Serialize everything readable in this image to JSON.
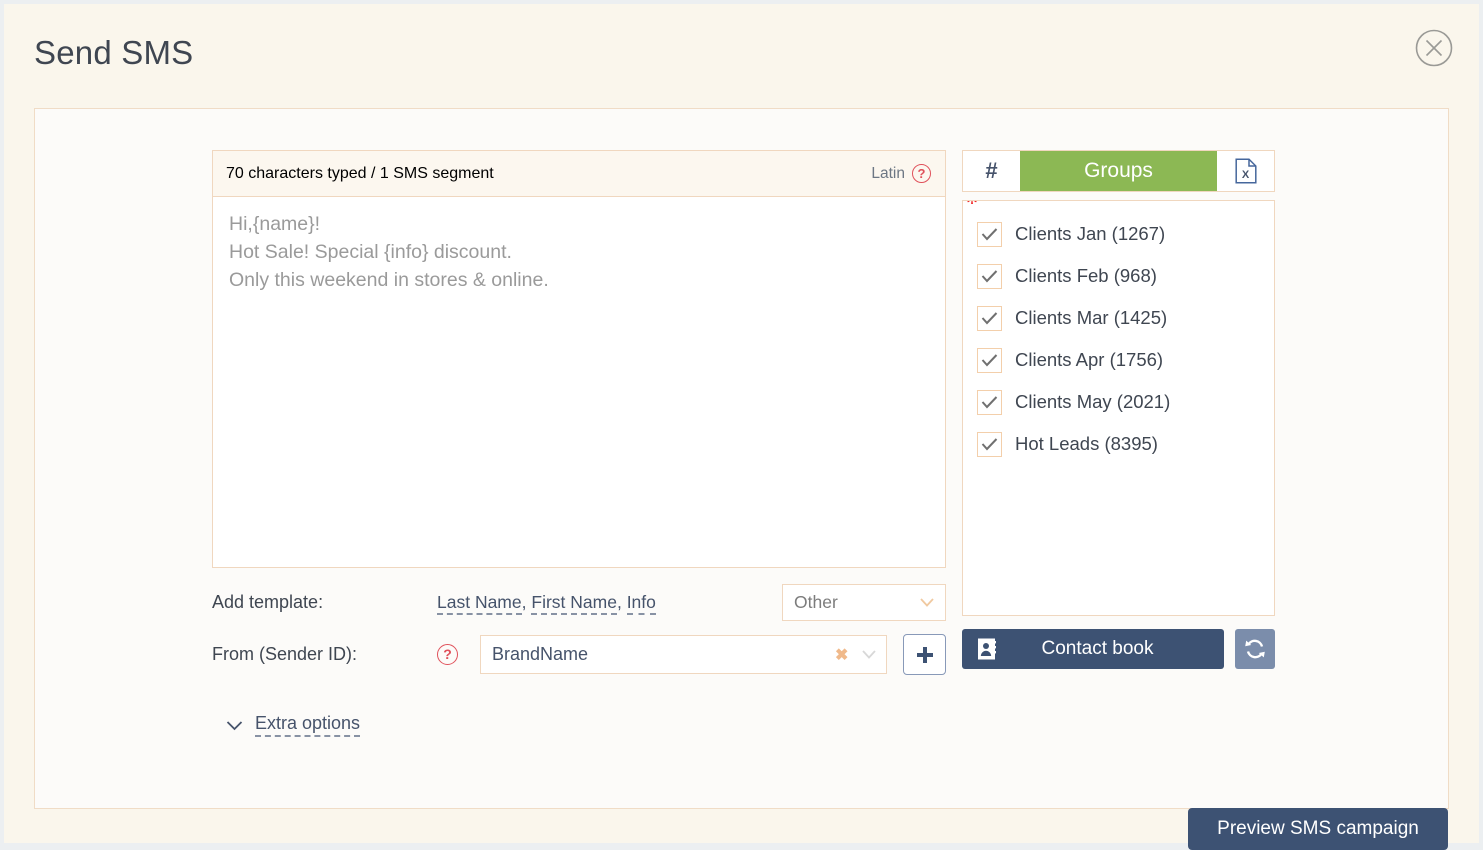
{
  "dialog": {
    "title": "Send SMS",
    "close_icon": "close-circle-icon"
  },
  "message": {
    "counter": "70 characters typed / 1 SMS segment",
    "charset": "Latin",
    "help_glyph": "?",
    "body": "Hi,{name}!\nHot Sale! Special {info} discount.\nOnly this weekend in stores & online."
  },
  "template": {
    "label": "Add template:",
    "links": [
      "Last Name",
      "First Name",
      "Info"
    ],
    "separator": ", ",
    "other_select": "Other"
  },
  "sender": {
    "label": "From (Sender ID):",
    "help_glyph": "?",
    "value": "BrandName",
    "clear_glyph": "✖",
    "add_glyph": "+"
  },
  "extra": {
    "label": "Extra options"
  },
  "recipients": {
    "tabs": [
      {
        "label": "#",
        "name": "tab-numbers",
        "active": false
      },
      {
        "label": "Groups",
        "name": "tab-groups",
        "active": true
      },
      {
        "label": "",
        "name": "tab-file-upload",
        "active": false
      }
    ],
    "required_marker": "*",
    "groups": [
      {
        "label": "Clients Jan (1267)",
        "checked": true
      },
      {
        "label": "Clients Feb (968)",
        "checked": true
      },
      {
        "label": "Clients Mar (1425)",
        "checked": true
      },
      {
        "label": "Clients Apr (1756)",
        "checked": true
      },
      {
        "label": "Clients May (2021)",
        "checked": true
      },
      {
        "label": "Hot Leads (8395)",
        "checked": true
      }
    ],
    "contact_book_label": "Contact book",
    "refresh_icon": "refresh-icon"
  },
  "actions": {
    "preview_label": "Preview SMS campaign"
  },
  "colors": {
    "accent_green": "#8cb854",
    "navy": "#3d5273",
    "border_peach": "#f0d7bf",
    "required_red": "#f01b1b",
    "page_bg": "#faf6ec"
  }
}
